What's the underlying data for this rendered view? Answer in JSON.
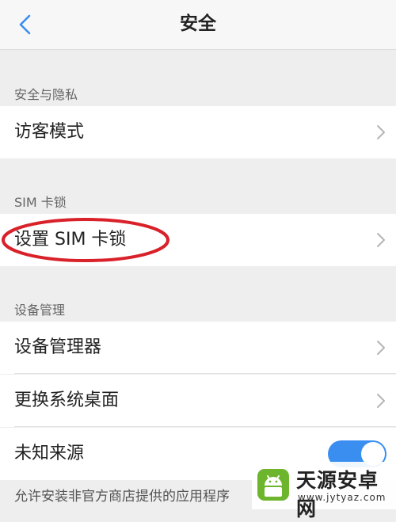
{
  "header": {
    "title": "安全",
    "back_icon": "chevron-left-icon",
    "accent_color": "#3a8ef0"
  },
  "sections": [
    {
      "label": "安全与隐私",
      "items": [
        {
          "label": "访客模式",
          "control": "chevron"
        }
      ]
    },
    {
      "label": "SIM 卡锁",
      "items": [
        {
          "label": "设置 SIM 卡锁",
          "control": "chevron",
          "highlighted": true
        }
      ]
    },
    {
      "label": "设备管理",
      "items": [
        {
          "label": "设备管理器",
          "control": "chevron"
        },
        {
          "label": "更换系统桌面",
          "control": "chevron"
        },
        {
          "label": "未知来源",
          "control": "toggle",
          "toggle_on": true
        }
      ]
    }
  ],
  "footer_note": "允许安装非官方商店提供的应用程序",
  "highlight_color": "#d9212a",
  "watermark": {
    "title": "天源安卓网",
    "url": "www.jytyaz.com"
  }
}
